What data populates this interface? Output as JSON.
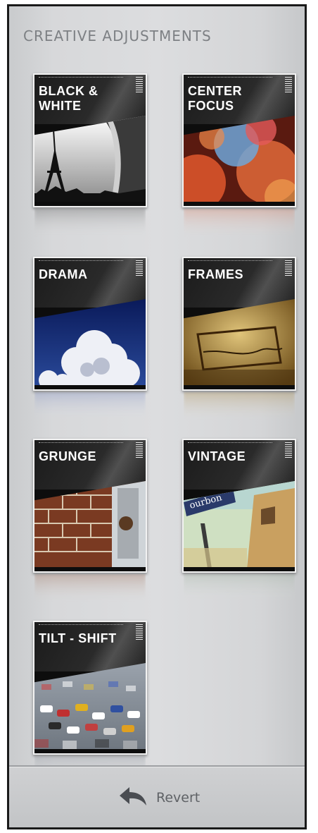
{
  "panel": {
    "title": "CREATIVE ADJUSTMENTS"
  },
  "adjustments": [
    {
      "label": "BLACK &\nWHITE",
      "icon": "black-white-preset-icon"
    },
    {
      "label": "CENTER\nFOCUS",
      "icon": "center-focus-preset-icon"
    },
    {
      "label": "DRAMA",
      "icon": "drama-preset-icon"
    },
    {
      "label": "FRAMES",
      "icon": "frames-preset-icon"
    },
    {
      "label": "GRUNGE",
      "icon": "grunge-preset-icon"
    },
    {
      "label": "VINTAGE",
      "icon": "vintage-preset-icon"
    },
    {
      "label": "TILT - SHIFT",
      "icon": "tilt-shift-preset-icon"
    }
  ],
  "footer": {
    "revert_label": "Revert",
    "revert_icon": "revert-arrow-icon"
  }
}
